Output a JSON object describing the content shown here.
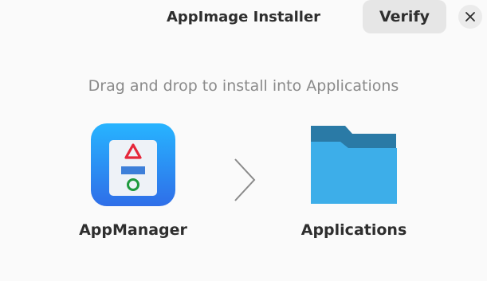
{
  "window": {
    "title": "AppImage Installer"
  },
  "header": {
    "verify_label": "Verify",
    "close_icon": "close-icon"
  },
  "main": {
    "instruction": "Drag and drop to install into Applications",
    "source": {
      "name": "AppManager",
      "icon": "appmanager-icon"
    },
    "arrow_icon": "chevron-right-icon",
    "destination": {
      "name": "Applications",
      "icon": "folder-icon"
    }
  },
  "colors": {
    "background": "#fafafa",
    "app_icon_blue": "#2f7bf0",
    "folder_light": "#3daee9",
    "folder_dark": "#2a7aa6",
    "triangle_red": "#e5273a",
    "bar_blue": "#3d7fd9",
    "circle_green": "#1f9a3e"
  }
}
